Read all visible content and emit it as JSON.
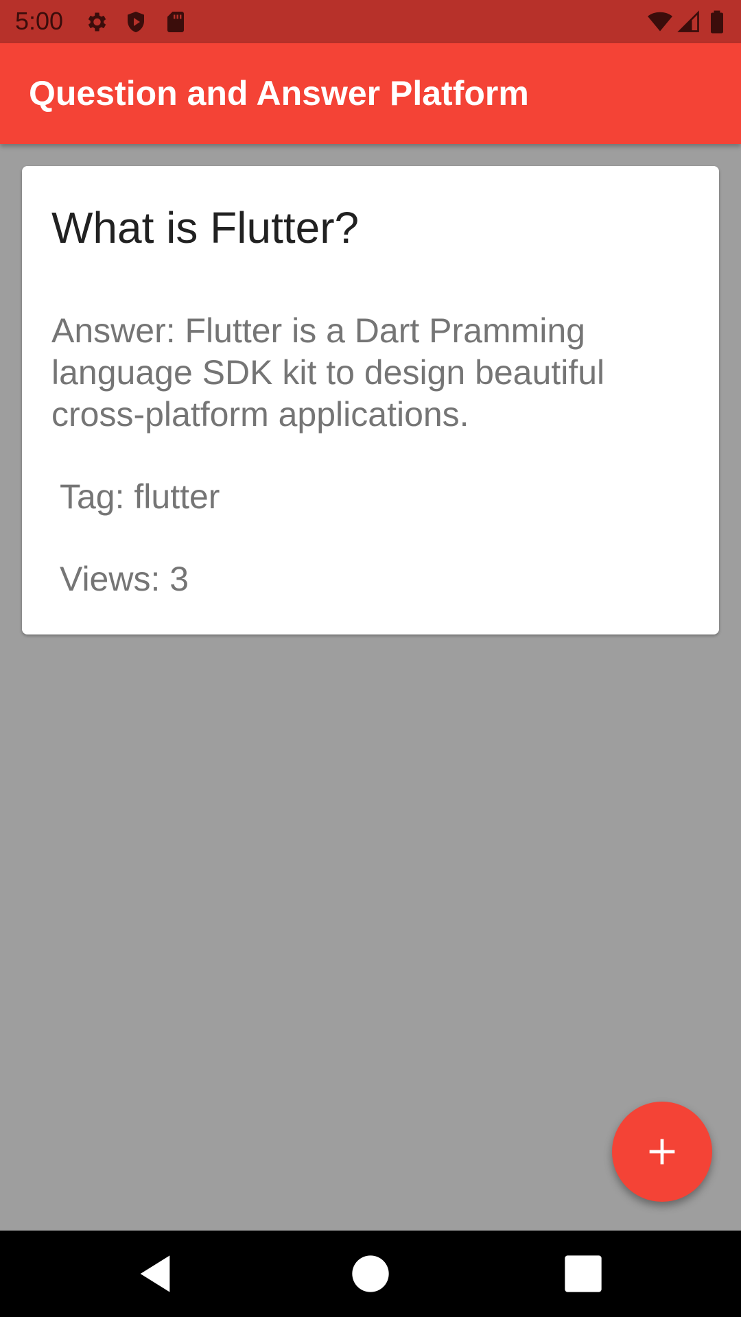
{
  "status_bar": {
    "time": "5:00",
    "icons": [
      "gear-icon",
      "shield-icon",
      "sd-card-icon",
      "wifi-icon",
      "signal-icon",
      "battery-icon"
    ]
  },
  "app_bar": {
    "title": "Question and Answer Platform"
  },
  "question_card": {
    "title": "What is Flutter?",
    "answer": "Answer: Flutter is a Dart Pramming language SDK kit to design beautiful cross-platform applications.",
    "tag": "Tag: flutter",
    "views": "Views: 3"
  },
  "fab": {
    "icon": "plus-icon"
  },
  "nav_bar": {
    "icons": [
      "back-icon",
      "home-icon",
      "recents-icon"
    ]
  },
  "colors": {
    "status_bar": "#b7312a",
    "app_bar": "#f44336",
    "background": "#9e9e9e",
    "card": "#ffffff",
    "fab": "#f44336",
    "nav_bar": "#000000"
  }
}
